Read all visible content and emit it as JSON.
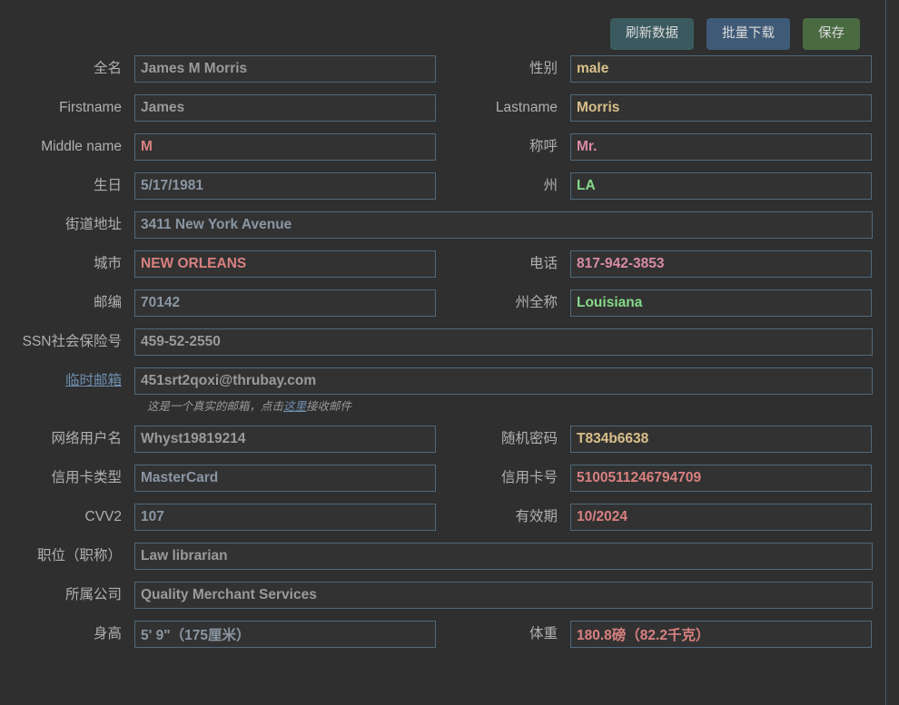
{
  "toolbar": {
    "refresh_label": "刷新数据",
    "batch_download_label": "批量下载",
    "save_label": "保存",
    "refresh_color": "#3b5a60",
    "batch_color": "#3f5a77",
    "save_color": "#4a6b42"
  },
  "fields": {
    "fullname": {
      "label": "全名",
      "value": "James M Morris"
    },
    "gender": {
      "label": "性别",
      "value": "male"
    },
    "firstname": {
      "label": "Firstname",
      "value": "James"
    },
    "lastname": {
      "label": "Lastname",
      "value": "Morris"
    },
    "middlename": {
      "label": "Middle name",
      "value": "M"
    },
    "title": {
      "label": "称呼",
      "value": "Mr."
    },
    "birthday": {
      "label": "生日",
      "value": "5/17/1981"
    },
    "state": {
      "label": "州",
      "value": "LA"
    },
    "street": {
      "label": "街道地址",
      "value": "3411 New York Avenue"
    },
    "city": {
      "label": "城市",
      "value": "NEW ORLEANS"
    },
    "phone": {
      "label": "电话",
      "value": "817-942-3853"
    },
    "zipcode": {
      "label": "邮编",
      "value": "70142"
    },
    "statefull": {
      "label": "州全称",
      "value": "Louisiana"
    },
    "ssn": {
      "label": "SSN社会保险号",
      "value": "459-52-2550"
    },
    "email": {
      "label": "临时邮箱",
      "value": "451srt2qoxi@thrubay.com"
    },
    "username": {
      "label": "网络用户名",
      "value": "Whyst19819214"
    },
    "password": {
      "label": "随机密码",
      "value": "T834b6638"
    },
    "cardtype": {
      "label": "信用卡类型",
      "value": "MasterCard"
    },
    "cardnumber": {
      "label": "信用卡号",
      "value": "5100511246794709"
    },
    "cvv2": {
      "label": "CVV2",
      "value": "107"
    },
    "expiry": {
      "label": "有效期",
      "value": "10/2024"
    },
    "job": {
      "label": "职位（职称）",
      "value": "Law librarian"
    },
    "company": {
      "label": "所属公司",
      "value": "Quality Merchant Services"
    },
    "height": {
      "label": "身高",
      "value": "5' 9\"（175厘米）"
    },
    "weight": {
      "label": "体重",
      "value": "180.8磅（82.2千克）"
    }
  },
  "email_hint": {
    "before": "这是一个真实的邮箱，点击",
    "link": "这里",
    "after": "接收邮件"
  }
}
